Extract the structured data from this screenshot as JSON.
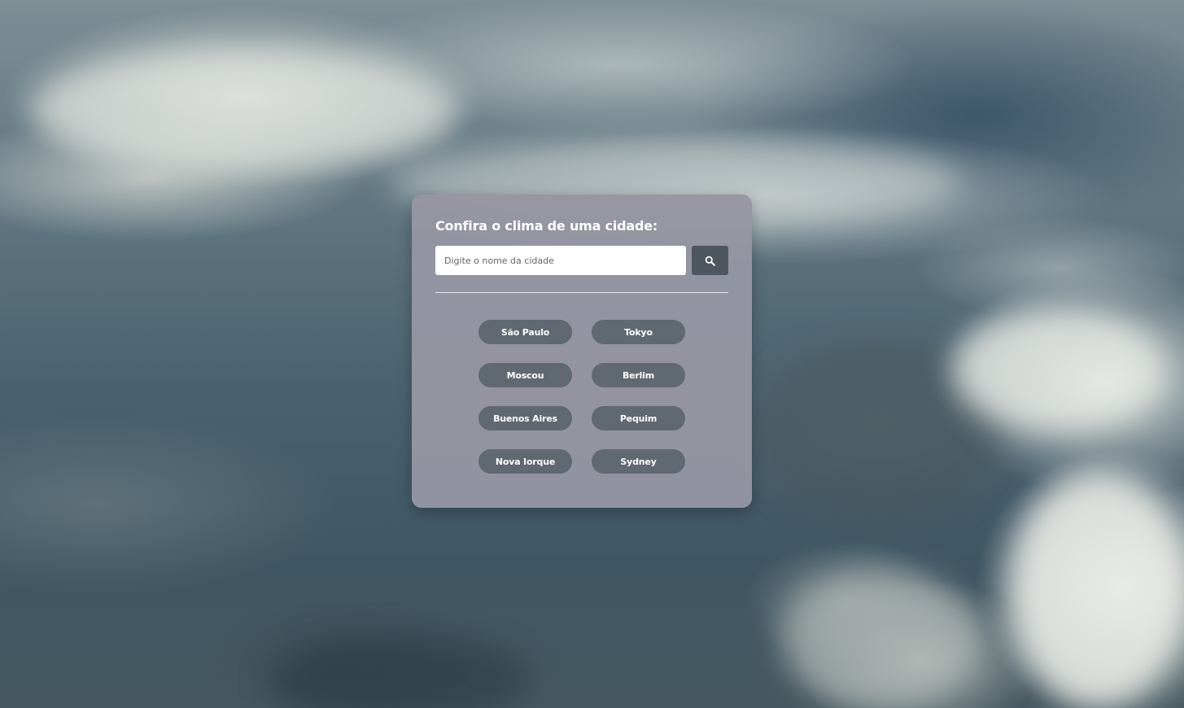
{
  "search": {
    "title": "Confira o clima de uma cidade:",
    "placeholder": "Digite o nome da cidade",
    "value": "",
    "button_icon": "search-icon"
  },
  "cities": [
    {
      "label": "São Paulo"
    },
    {
      "label": "Tokyo"
    },
    {
      "label": "Moscou"
    },
    {
      "label": "Berlim"
    },
    {
      "label": "Buenos Aires"
    },
    {
      "label": "Pequim"
    },
    {
      "label": "Nova Iorque"
    },
    {
      "label": "Sydney"
    }
  ],
  "colors": {
    "card_background": "#96969f",
    "search_button": "#4e5660",
    "city_button": "#606872",
    "text": "#ffffff"
  }
}
